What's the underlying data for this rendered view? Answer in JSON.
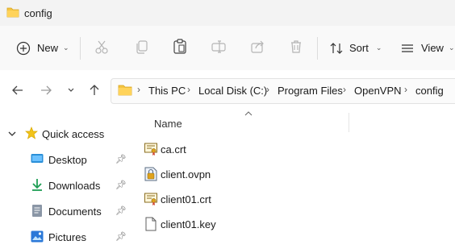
{
  "window": {
    "title": "config"
  },
  "toolbar": {
    "new_label": "New",
    "sort_label": "Sort",
    "view_label": "View"
  },
  "address": {
    "crumbs": [
      "This PC",
      "Local Disk (C:)",
      "Program Files",
      "OpenVPN",
      "config"
    ]
  },
  "nav": {
    "items": [
      {
        "label": "Quick access",
        "icon": "star-icon",
        "pinned": false
      },
      {
        "label": "Desktop",
        "icon": "desktop-icon",
        "pinned": true
      },
      {
        "label": "Downloads",
        "icon": "download-icon",
        "pinned": true
      },
      {
        "label": "Documents",
        "icon": "documents-icon",
        "pinned": true
      },
      {
        "label": "Pictures",
        "icon": "pictures-icon",
        "pinned": true
      }
    ]
  },
  "filelist": {
    "column_name": "Name",
    "files": [
      {
        "name": "ca.crt",
        "icon": "certificate-icon"
      },
      {
        "name": "client.ovpn",
        "icon": "ovpn-config-icon"
      },
      {
        "name": "client01.crt",
        "icon": "certificate-icon"
      },
      {
        "name": "client01.key",
        "icon": "file-icon"
      }
    ]
  },
  "colors": {
    "folder": "#f4c542",
    "accent": "#0067c0",
    "titlebar": "#f3f3f3"
  }
}
